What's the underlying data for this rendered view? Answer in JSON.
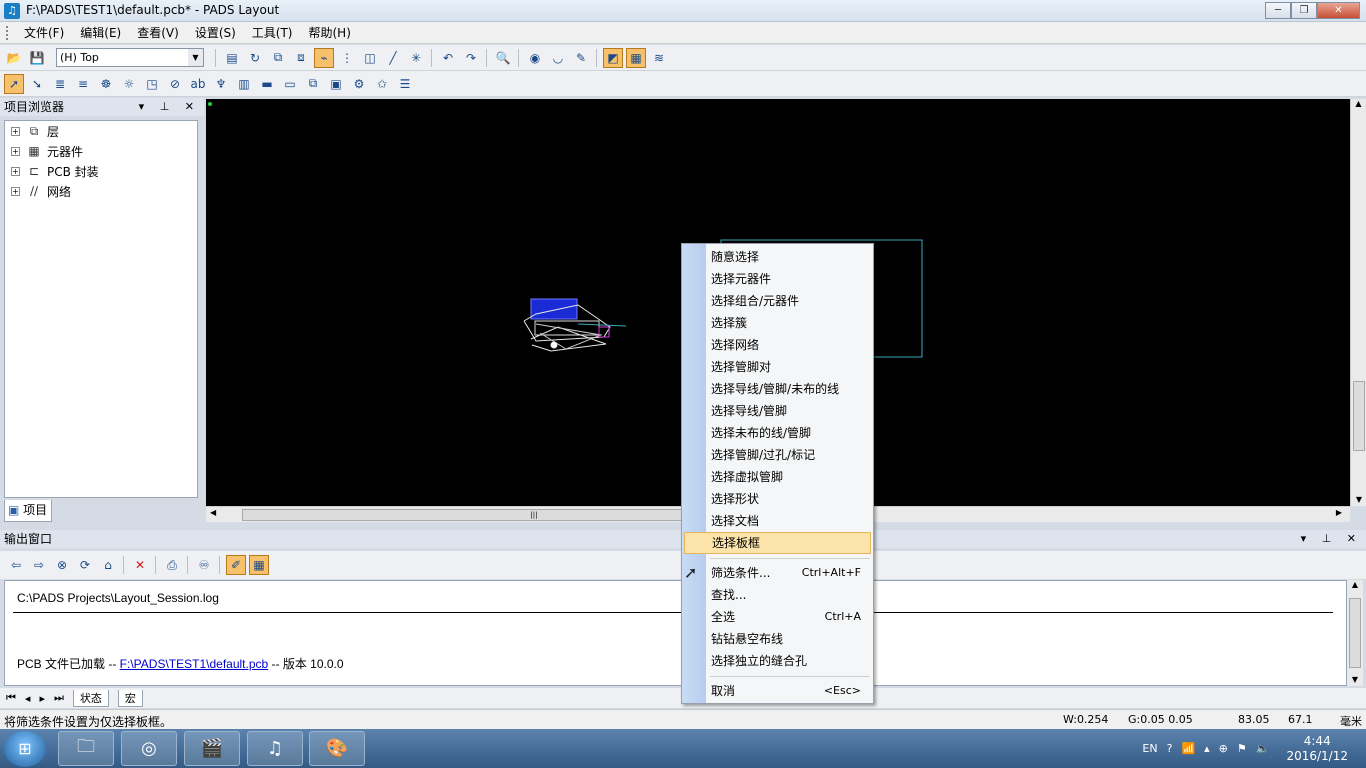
{
  "window": {
    "title": "F:\\PADS\\TEST1\\default.pcb* - PADS Layout",
    "app_icon": "pads-icon"
  },
  "menu": [
    "文件(F)",
    "编辑(E)",
    "查看(V)",
    "设置(S)",
    "工具(T)",
    "帮助(H)"
  ],
  "toolbar": {
    "layer_select": "(H) Top"
  },
  "project_browser": {
    "title": "项目浏览器",
    "items": [
      "层",
      "元器件",
      "PCB 封装",
      "网络"
    ],
    "tab": "项目"
  },
  "context_menu": {
    "items": [
      {
        "label": "随意选择",
        "shortcut": ""
      },
      {
        "label": "选择元器件",
        "shortcut": ""
      },
      {
        "label": "选择组合/元器件",
        "shortcut": ""
      },
      {
        "label": "选择簇",
        "shortcut": ""
      },
      {
        "label": "选择网络",
        "shortcut": ""
      },
      {
        "label": "选择管脚对",
        "shortcut": ""
      },
      {
        "label": "选择导线/管脚/未布的线",
        "shortcut": ""
      },
      {
        "label": "选择导线/管脚",
        "shortcut": ""
      },
      {
        "label": "选择未布的线/管脚",
        "shortcut": ""
      },
      {
        "label": "选择管脚/过孔/标记",
        "shortcut": ""
      },
      {
        "label": "选择虚拟管脚",
        "shortcut": ""
      },
      {
        "label": "选择形状",
        "shortcut": ""
      },
      {
        "label": "选择文档",
        "shortcut": ""
      },
      {
        "label": "选择板框",
        "shortcut": ""
      },
      {
        "label": "筛选条件...",
        "shortcut": "Ctrl+Alt+F"
      },
      {
        "label": "查找...",
        "shortcut": ""
      },
      {
        "label": "全选",
        "shortcut": "Ctrl+A"
      },
      {
        "label": "钻钻悬空布线",
        "shortcut": ""
      },
      {
        "label": "选择独立的缝合孔",
        "shortcut": ""
      },
      {
        "label": "取消",
        "shortcut": "<Esc>"
      }
    ],
    "highlighted": "选择板框"
  },
  "output": {
    "title": "输出窗口",
    "log_path": "C:\\PADS Projects\\Layout_Session.log",
    "loaded_prefix": "PCB 文件已加载  -- ",
    "loaded_link": "F:\\PADS\\TEST1\\default.pcb",
    "loaded_suffix": "  -- 版本  10.0.0",
    "tabs": [
      "状态",
      "宏"
    ]
  },
  "status": {
    "message": "将筛选条件设置为仅选择板框。",
    "width": "W:0.254",
    "grid": "G:0.05 0.05",
    "x": "83.05",
    "y": "67.1",
    "units": "毫米"
  },
  "taskbar": {
    "lang": "EN",
    "time": "4:44",
    "date": "2016/1/12"
  },
  "colors": {
    "canvas": "#000000",
    "board_outline": "#3aa7b8",
    "highlight": "#fbe3a9"
  }
}
